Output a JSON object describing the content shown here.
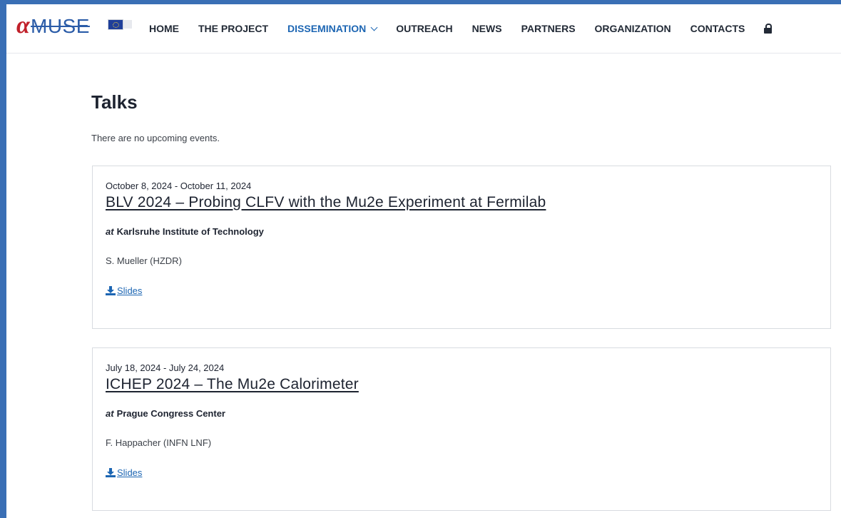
{
  "logo": {
    "alpha": "α",
    "wordmark": "MUSE"
  },
  "nav": {
    "items": [
      {
        "label": "HOME"
      },
      {
        "label": "THE PROJECT"
      },
      {
        "label": "DISSEMINATION"
      },
      {
        "label": "OUTREACH"
      },
      {
        "label": "NEWS"
      },
      {
        "label": "PARTNERS"
      },
      {
        "label": "ORGANIZATION"
      },
      {
        "label": "CONTACTS"
      }
    ],
    "active": "DISSEMINATION",
    "lock_icon": "lock-icon",
    "dropdown_icon": "chevron-down-icon"
  },
  "page": {
    "title": "Talks",
    "no_events": "There are no upcoming events."
  },
  "talks": [
    {
      "dates": "October 8, 2024 - October 11, 2024",
      "title": "BLV 2024 – Probing CLFV with the Mu2e Experiment at Fermilab",
      "at": "at",
      "venue": "Karlsruhe Institute of Technology",
      "speaker": "S. Mueller (HZDR)",
      "slides": "Slides"
    },
    {
      "dates": "July 18, 2024 - July 24, 2024",
      "title": "ICHEP 2024 – The Mu2e Calorimeter",
      "at": "at",
      "venue": "Prague Congress Center",
      "speaker": "F. Happacher (INFN LNF)",
      "slides": "Slides"
    }
  ],
  "colors": {
    "accent": "#1d66b3",
    "frame": "#3a6fb5",
    "logo_red": "#c0202a",
    "text": "#1d2330"
  }
}
